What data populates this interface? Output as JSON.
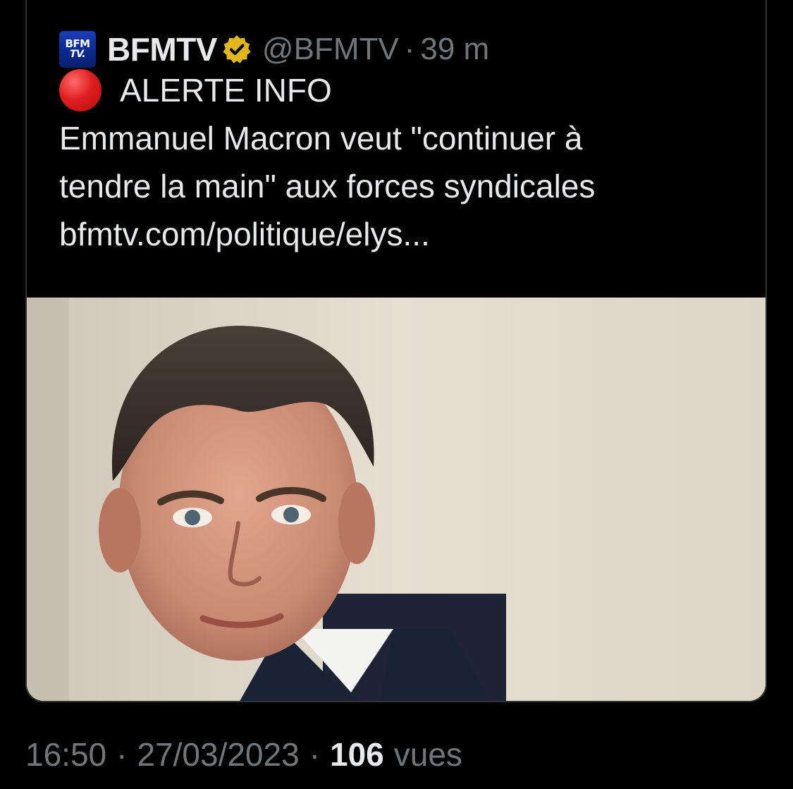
{
  "tweet": {
    "avatar_line_1": "BFM",
    "avatar_line_2": "TV.",
    "display_name": "BFMTV",
    "handle": "@BFMTV",
    "separator": "·",
    "time_ago": "39 m",
    "alert_label": "ALERTE INFO",
    "body_line_1": "Emmanuel Macron veut \"continuer à",
    "body_line_2": "tendre la main\" aux forces syndicales",
    "link_text": "bfmtv.com/politique/elys...",
    "icons": {
      "verified": "verified-badge-icon",
      "alert": "red-circle-icon"
    },
    "colors": {
      "verified_badge": "#e2b719",
      "alert_red": "#e01e1e",
      "muted_text": "#71767b",
      "primary_text": "#e7e9ea",
      "avatar_blue": "#0a2a8f"
    }
  },
  "meta": {
    "time": "16:50",
    "separator": "·",
    "date": "27/03/2023",
    "views_count": "106",
    "views_label": "vues"
  }
}
